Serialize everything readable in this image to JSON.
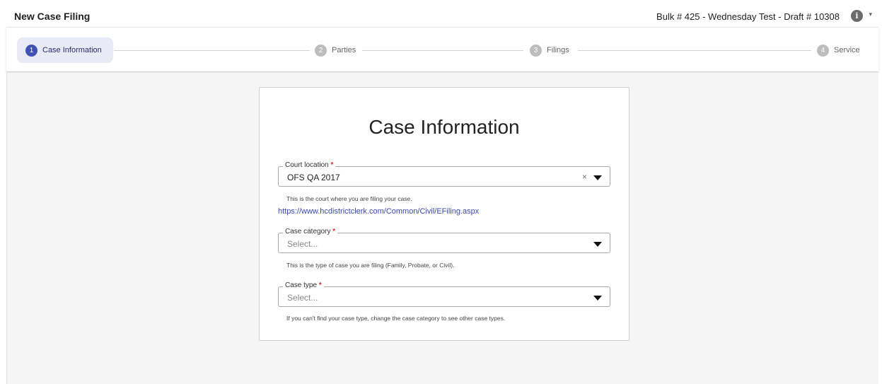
{
  "header": {
    "title": "New Case Filing",
    "draft_info": "Bulk # 425 - Wednesday Test - Draft # 10308",
    "info_icon": "info-icon",
    "caret": "▾"
  },
  "stepper": {
    "steps": [
      {
        "num": "1",
        "label": "Case Information",
        "active": true
      },
      {
        "num": "2",
        "label": "Parties",
        "active": false
      },
      {
        "num": "3",
        "label": "Filings",
        "active": false
      },
      {
        "num": "4",
        "label": "Service",
        "active": false
      }
    ]
  },
  "form": {
    "heading": "Case Information",
    "court_location": {
      "label": "Court location",
      "required_mark": "*",
      "value": "OFS QA 2017",
      "clear": "×",
      "hint": "This is the court where you are filing your case."
    },
    "link": "https://www.hcdistrictclerk.com/Common/Civil/EFiling.aspx",
    "case_category": {
      "label": "Case category",
      "required_mark": "*",
      "placeholder": "Select...",
      "hint": "This is the type of case you are filing (Family, Probate, or Civil)."
    },
    "case_type": {
      "label": "Case type",
      "required_mark": "*",
      "placeholder": "Select...",
      "hint": "If you can't find your case type, change the case category to see other case types."
    }
  },
  "colors": {
    "accent": "#3f51b5",
    "active_step_bg": "#e8eaf6",
    "required": "#d32f2f",
    "link": "#3949ab"
  }
}
